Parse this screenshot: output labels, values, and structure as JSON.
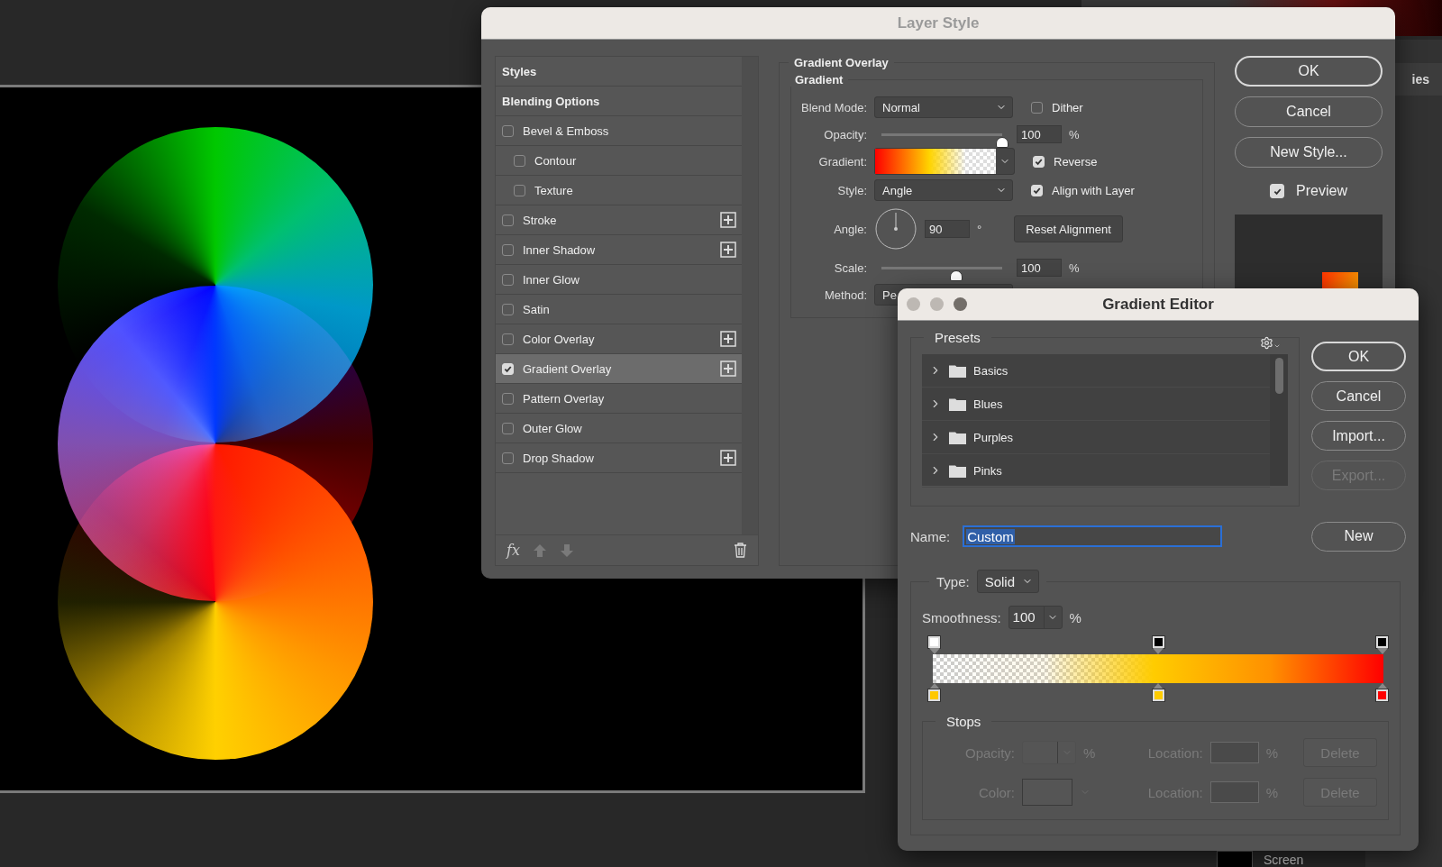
{
  "background": {
    "tab_label": "ies",
    "layer_name": "Screen"
  },
  "layer_style": {
    "title": "Layer Style",
    "styles": [
      {
        "label": "Styles",
        "kind": "header",
        "selected": false
      },
      {
        "label": "Blending Options",
        "kind": "header",
        "selected": false
      },
      {
        "label": "Bevel & Emboss",
        "kind": "effect",
        "checked": false,
        "addable": false,
        "selected": false
      },
      {
        "label": "Contour",
        "kind": "sub",
        "checked": false,
        "addable": false,
        "selected": false
      },
      {
        "label": "Texture",
        "kind": "sub",
        "checked": false,
        "addable": false,
        "selected": false
      },
      {
        "label": "Stroke",
        "kind": "effect",
        "checked": false,
        "addable": true,
        "selected": false
      },
      {
        "label": "Inner Shadow",
        "kind": "effect",
        "checked": false,
        "addable": true,
        "selected": false
      },
      {
        "label": "Inner Glow",
        "kind": "effect",
        "checked": false,
        "addable": false,
        "selected": false
      },
      {
        "label": "Satin",
        "kind": "effect",
        "checked": false,
        "addable": false,
        "selected": false
      },
      {
        "label": "Color Overlay",
        "kind": "effect",
        "checked": false,
        "addable": true,
        "selected": false
      },
      {
        "label": "Gradient Overlay",
        "kind": "effect",
        "checked": true,
        "addable": true,
        "selected": true
      },
      {
        "label": "Pattern Overlay",
        "kind": "effect",
        "checked": false,
        "addable": false,
        "selected": false
      },
      {
        "label": "Outer Glow",
        "kind": "effect",
        "checked": false,
        "addable": false,
        "selected": false
      },
      {
        "label": "Drop Shadow",
        "kind": "effect",
        "checked": false,
        "addable": true,
        "selected": false
      }
    ],
    "footer_fx": "fx",
    "gradient_overlay": {
      "title": "Gradient Overlay",
      "group_title": "Gradient",
      "blend_mode": {
        "label": "Blend Mode:",
        "value": "Normal"
      },
      "dither": {
        "label": "Dither",
        "checked": false
      },
      "opacity": {
        "label": "Opacity:",
        "level": 1,
        "value": "100",
        "unit": "%"
      },
      "gradient": {
        "label": "Gradient:"
      },
      "reverse": {
        "label": "Reverse",
        "checked": true
      },
      "style": {
        "label": "Style:",
        "value": "Angle"
      },
      "align": {
        "label": "Align with Layer",
        "checked": true
      },
      "angle": {
        "label": "Angle:",
        "value": "90",
        "unit": "°"
      },
      "reset_button": "Reset Alignment",
      "scale": {
        "label": "Scale:",
        "level": 0.62,
        "value": "100",
        "unit": "%"
      },
      "method": {
        "label": "Method:",
        "value": "Pe"
      }
    },
    "buttons": [
      {
        "label": "OK",
        "default": true
      },
      {
        "label": "Cancel",
        "default": false
      },
      {
        "label": "New Style...",
        "default": false
      }
    ],
    "preview": {
      "label": "Preview",
      "checked": true
    }
  },
  "gradient_editor": {
    "title": "Gradient Editor",
    "presets": {
      "title": "Presets",
      "items": [
        {
          "label": "Basics",
          "expanded": false
        },
        {
          "label": "Blues",
          "expanded": false
        },
        {
          "label": "Purples",
          "expanded": false
        },
        {
          "label": "Pinks",
          "expanded": false
        }
      ]
    },
    "buttons": [
      {
        "label": "OK",
        "default": true,
        "disabled": false
      },
      {
        "label": "Cancel",
        "default": false,
        "disabled": false
      },
      {
        "label": "Import...",
        "default": false,
        "disabled": false
      },
      {
        "label": "Export...",
        "default": false,
        "disabled": true
      }
    ],
    "name": {
      "label": "Name:",
      "value": "Custom",
      "selected": true
    },
    "new_button": "New",
    "type": {
      "label": "Type:",
      "value": "Solid"
    },
    "smoothness": {
      "label": "Smoothness:",
      "value": "100",
      "unit": "%"
    },
    "opacity_stops": [
      {
        "color": "#ffffff"
      },
      {
        "color": "#000000"
      },
      {
        "color": "#000000"
      }
    ],
    "color_stops": [
      {
        "color": "#ffc800"
      },
      {
        "color": "#ffcc00"
      },
      {
        "color": "#ff0000"
      }
    ],
    "stops": {
      "title": "Stops",
      "rows": [
        {
          "kind": "opacity",
          "label": "Opacity:",
          "unit": "%",
          "location_label": "Location:",
          "location_unit": "%",
          "delete": "Delete",
          "disabled": true
        },
        {
          "kind": "color",
          "label": "Color:",
          "location_label": "Location:",
          "location_unit": "%",
          "delete": "Delete",
          "disabled": true
        }
      ]
    }
  }
}
